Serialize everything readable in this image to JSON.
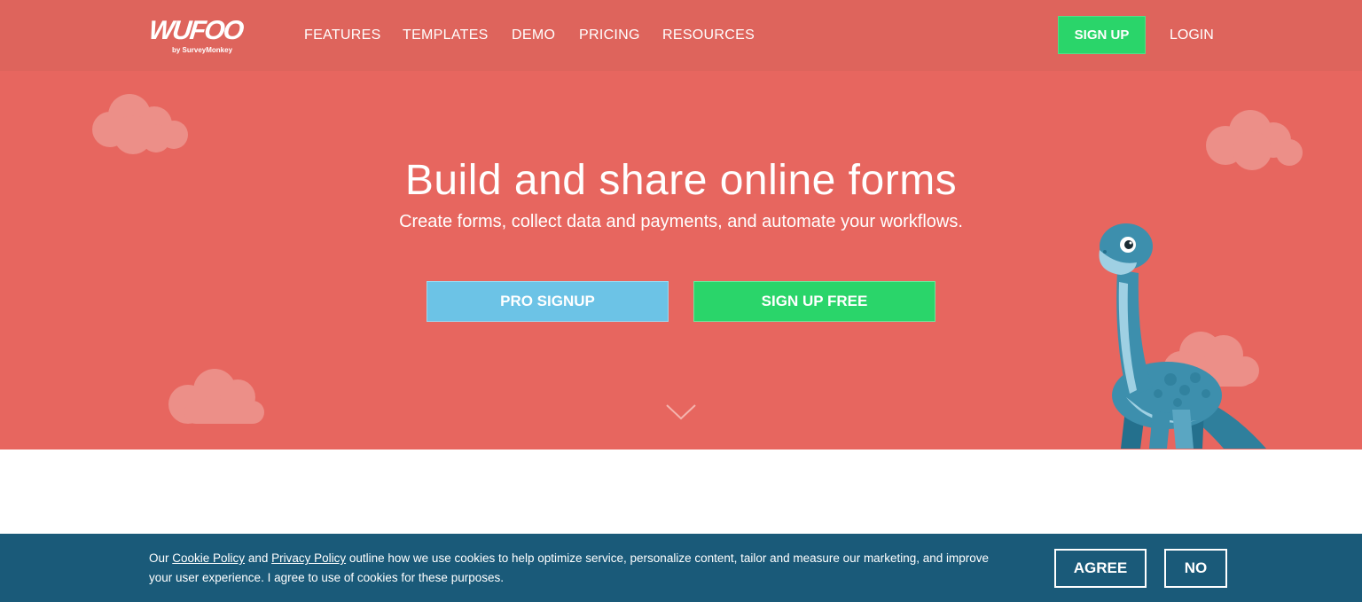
{
  "header": {
    "logo_text": "WUFOO",
    "logo_sub": "by SurveyMonkey",
    "nav": [
      "FEATURES",
      "TEMPLATES",
      "DEMO",
      "PRICING",
      "RESOURCES"
    ],
    "signup_label": "SIGN UP",
    "login_label": "LOGIN"
  },
  "hero": {
    "title": "Build and share online forms",
    "subtitle": "Create forms, collect data and payments, and automate your workflows.",
    "pro_button": "PRO SIGNUP",
    "free_button": "SIGN UP FREE"
  },
  "cookie_banner": {
    "text_prefix": "Our ",
    "cookie_link": "Cookie Policy",
    "text_and": " and ",
    "privacy_link": "Privacy Policy",
    "text_rest": " outline how we use cookies to help optimize service, personalize content, tailor and measure our marketing, and improve your user experience. I agree to use of cookies for these purposes.",
    "agree_label": "AGREE",
    "no_label": "NO"
  },
  "colors": {
    "header_bg": "#de645c",
    "hero_bg": "#e7665f",
    "green": "#2ad56a",
    "blue": "#6cc3e6",
    "cookie_bg": "#1a5a79"
  },
  "icons": [
    "chevron-down-icon",
    "cloud-icon",
    "dinosaur-mascot"
  ]
}
